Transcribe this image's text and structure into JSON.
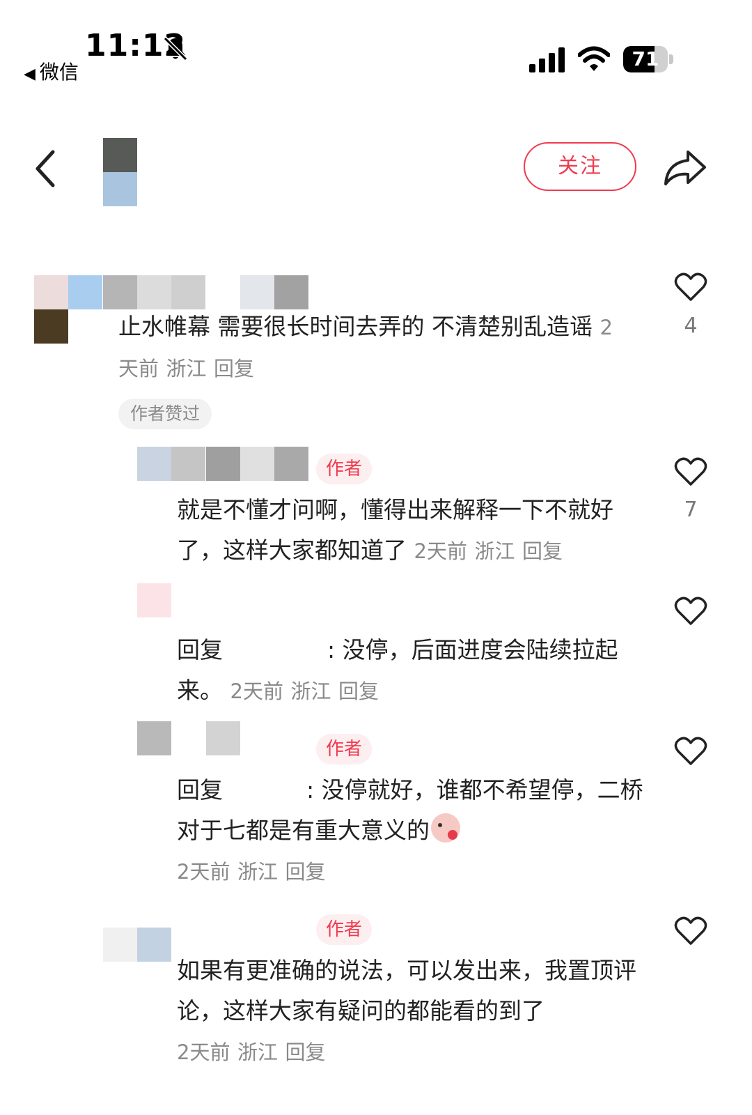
{
  "status_bar": {
    "time": "11:12",
    "back_app": "微信",
    "battery_percent": "71",
    "battery_level": 0.71
  },
  "header": {
    "follow_label": "关注"
  },
  "comments": [
    {
      "text": "止水帷幕 需要很长时间去弄的 不清楚别乱造谣",
      "time": "2天前",
      "location": "浙江",
      "reply": "回复",
      "likes": "4",
      "badge": "作者赞过",
      "replies": [
        {
          "author_tag": "作者",
          "text": "就是不懂才问啊，懂得出来解释一下不就好了，这样大家都知道了",
          "time": "2天前",
          "location": "浙江",
          "reply": "回复",
          "likes": "7"
        },
        {
          "reply_prefix": "回复",
          "text": ": 没停，后面进度会陆续拉起来。",
          "time": "2天前",
          "location": "浙江",
          "reply": "回复"
        },
        {
          "author_tag": "作者",
          "reply_prefix": "回复",
          "text": ": 没停就好，谁都不希望停，二桥对于七都是有重大意义的",
          "time": "2天前",
          "location": "浙江",
          "reply": "回复"
        },
        {
          "author_tag": "作者",
          "text": "如果有更准确的说法，可以发出来，我置顶评论，这样大家有疑问的都能看的到了",
          "time": "2天前",
          "location": "浙江",
          "reply": "回复"
        }
      ]
    }
  ],
  "icons": {
    "bell": "bell-slash-icon",
    "signal": "cellular-signal-icon",
    "wifi": "wifi-icon",
    "back": "chevron-left-icon",
    "share": "share-arrow-icon",
    "like": "heart-outline-icon"
  },
  "colors": {
    "accent": "#ef3b4f",
    "meta_text": "#8a8a8a"
  }
}
